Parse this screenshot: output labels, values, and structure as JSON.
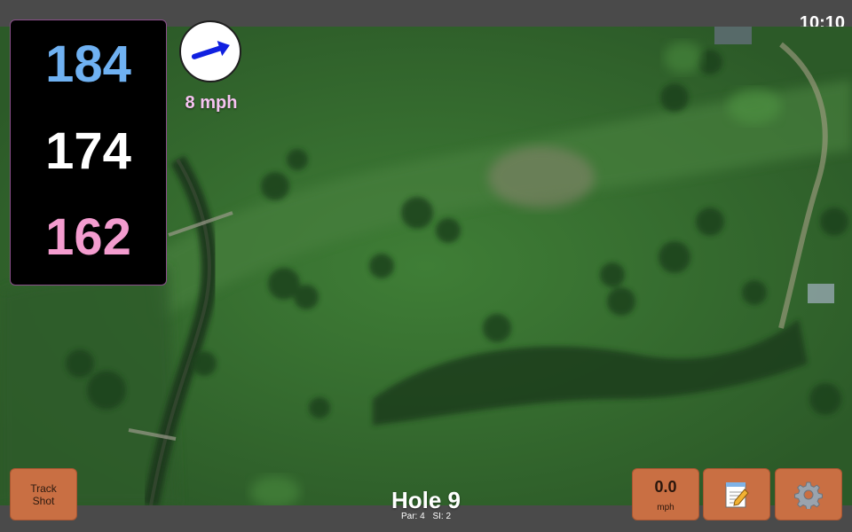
{
  "status_bar": {
    "time": "10:10"
  },
  "distances": {
    "back": "184",
    "middle": "174",
    "front": "162"
  },
  "wind": {
    "speed_label": "8 mph",
    "arrow_icon": "wind-arrow-icon",
    "arrow_color": "#1020e0"
  },
  "hole": {
    "title": "Hole 9",
    "par_label": "Par: 4",
    "si_label": "SI: 2"
  },
  "buttons": {
    "track_shot_line1": "Track",
    "track_shot_line2": "Shot",
    "speed_value": "0.0",
    "speed_unit": "mph",
    "notes_icon": "notepad-icon",
    "settings_icon": "gear-icon"
  },
  "colors": {
    "back_distance": "#6fb1f2",
    "middle_distance": "#ffffff",
    "front_distance": "#f49ccf",
    "button": "#c96f43",
    "fairway": "#3d7a34"
  }
}
